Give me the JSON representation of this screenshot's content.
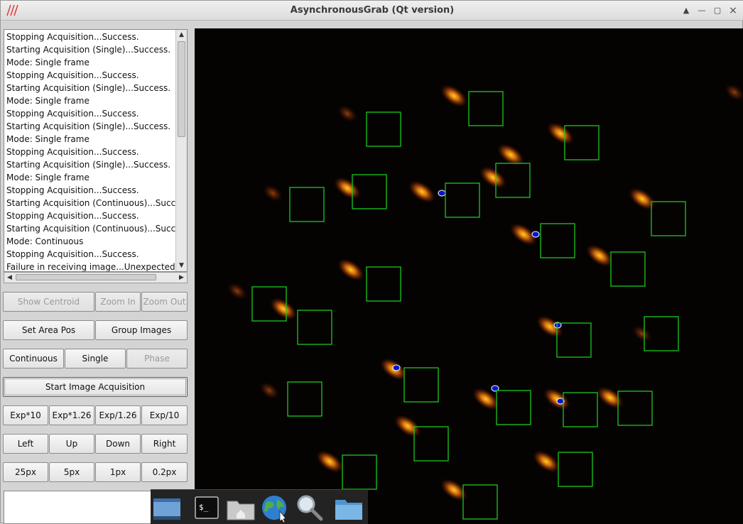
{
  "window": {
    "title": "AsynchronousGrab (Qt version)",
    "logo_icon": "red-slashes-logo-icon",
    "controls": [
      "restore-icon",
      "minimize-icon",
      "maximize-icon",
      "close-icon"
    ]
  },
  "log": {
    "lines": [
      "Stopping Acquisition...Success.",
      "Starting Acquisition (Single)...Success.",
      "Mode: Single frame",
      "Stopping Acquisition...Success.",
      "Starting Acquisition (Single)...Success.",
      "Mode: Single frame",
      "Stopping Acquisition...Success.",
      "Starting Acquisition (Single)...Success.",
      "Mode: Single frame",
      "Stopping Acquisition...Success.",
      "Starting Acquisition (Single)...Success.",
      "Mode: Single frame",
      "Stopping Acquisition...Success.",
      "Starting Acquisition (Continuous)...Success",
      "Stopping Acquisition...Success.",
      "Starting Acquisition (Continuous)...Success",
      "Mode: Continuous",
      "Stopping Acquisition...Success.",
      "Failure in receiving image...Unexpected fau"
    ]
  },
  "buttons": {
    "show_centroid": "Show Centroid",
    "zoom_in": "Zoom In",
    "zoom_out": "Zoom Out",
    "set_area_pos": "Set Area Pos",
    "group_images": "Group Images",
    "continuous": "Continuous",
    "single": "Single",
    "phase": "Phase",
    "start_acquisition": "Start Image Acquisition",
    "exp_x10": "Exp*10",
    "exp_x126": "Exp*1.26",
    "exp_div126": "Exp/1.26",
    "exp_div10": "Exp/10",
    "left": "Left",
    "up": "Up",
    "down": "Down",
    "right": "Right",
    "step_25": "25px",
    "step_5": "5px",
    "step_1": "1px",
    "step_02": "0.2px"
  },
  "taskbar": {
    "items": [
      "show-desktop-icon",
      "terminal-icon",
      "home-folder-icon",
      "web-browser-icon",
      "search-icon",
      "folder-icon"
    ]
  },
  "colors": {
    "box_outline": "#19c81e",
    "spot_core": "#0a14d2",
    "spot_hot": "#ffd21e",
    "spot_warm": "#c85000"
  }
}
